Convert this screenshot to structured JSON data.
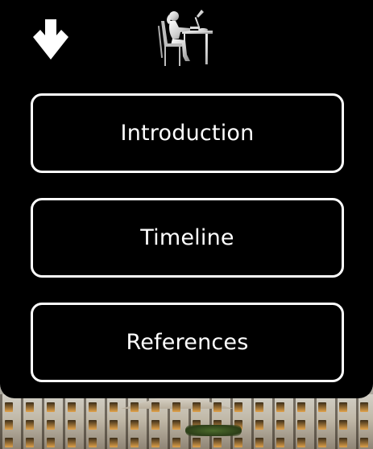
{
  "theme": {
    "panel_background": "#000000",
    "button_border": "#ffffff",
    "text_color": "#ffffff"
  },
  "header": {
    "toggle_icon": "arrow-down-icon",
    "logo_icon": "person-at-desk-icon"
  },
  "menu": {
    "items": [
      {
        "label": "Introduction"
      },
      {
        "label": "Timeline"
      },
      {
        "label": "References"
      }
    ]
  },
  "background": {
    "image": "building-facade-photo"
  }
}
